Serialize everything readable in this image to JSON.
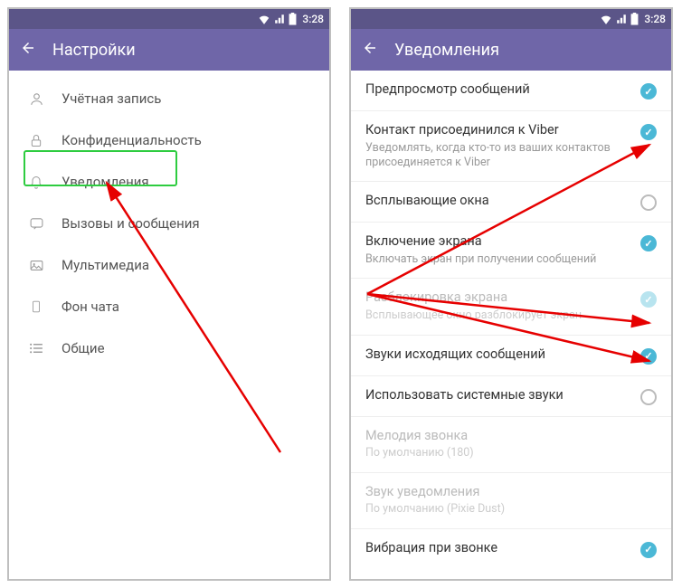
{
  "status": {
    "time": "3:28"
  },
  "screens": {
    "settings": {
      "title": "Настройки",
      "items": [
        {
          "icon": "user",
          "label": "Учётная запись"
        },
        {
          "icon": "lock",
          "label": "Конфиденциальность"
        },
        {
          "icon": "bell",
          "label": "Уведомления"
        },
        {
          "icon": "chat",
          "label": "Вызовы и сообщения"
        },
        {
          "icon": "media",
          "label": "Мультимедиа"
        },
        {
          "icon": "phone",
          "label": "Фон чата"
        },
        {
          "icon": "list",
          "label": "Общие"
        }
      ]
    },
    "notifications": {
      "title": "Уведомления",
      "items": [
        {
          "title": "Предпросмотр сообщений",
          "sub": "",
          "checked": true,
          "disabled": false
        },
        {
          "title": "Контакт присоединился к Viber",
          "sub": "Уведомлять, когда кто-то из ваших контактов присоединяется к Viber",
          "checked": true,
          "disabled": false
        },
        {
          "title": "Всплывающие окна",
          "sub": "",
          "checked": false,
          "disabled": false
        },
        {
          "title": "Включение экрана",
          "sub": "Включать экран при получении сообщений",
          "checked": true,
          "disabled": false
        },
        {
          "title": "Разблокировка экрана",
          "sub": "Всплывающее окно разблокирует экран",
          "checked": true,
          "disabled": true
        },
        {
          "title": "Звуки исходящих сообщений",
          "sub": "",
          "checked": true,
          "disabled": false
        },
        {
          "title": "Использовать системные звуки",
          "sub": "",
          "checked": false,
          "disabled": false
        },
        {
          "title": "Мелодия звонка",
          "sub": "По умолчанию (180)",
          "checked": null,
          "disabled": true
        },
        {
          "title": "Звук уведомления",
          "sub": "По умолчанию (Pixie Dust)",
          "checked": null,
          "disabled": true
        },
        {
          "title": "Вибрация при звонке",
          "sub": "",
          "checked": true,
          "disabled": false
        }
      ]
    }
  }
}
